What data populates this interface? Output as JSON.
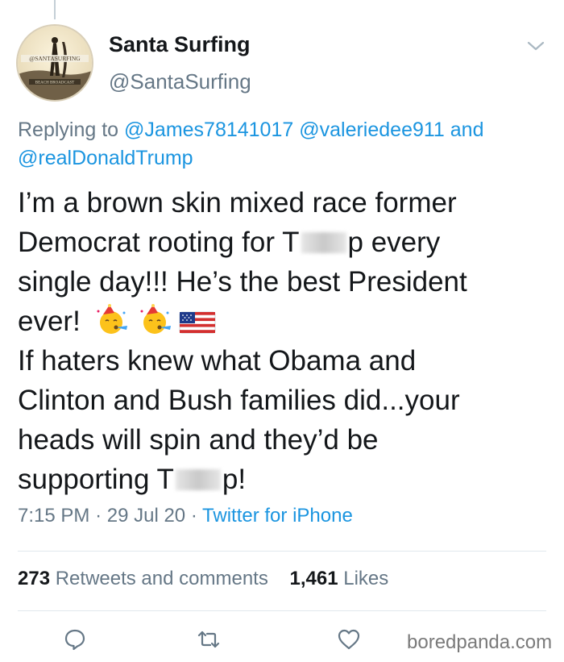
{
  "author": {
    "display_name": "Santa Surfing",
    "handle": "@SantaSurfing",
    "avatar_text_top": "@SANTASURFING",
    "avatar_text_bottom": "BEACH BROADCAST"
  },
  "reply": {
    "prefix": "Replying to",
    "mention_1": "@James78141017",
    "mention_2": "@valeriedee911",
    "conjunction": "and",
    "mention_3": "@realDonaldTrump"
  },
  "tweet": {
    "line_1": "I’m a brown skin mixed race former",
    "line_2a": "Democrat rooting for T",
    "line_2b": "p every",
    "line_3": "single day!!! He’s the best President",
    "line_4": "ever!",
    "line_5": "If haters knew what Obama and",
    "line_6": "Clinton and Bush families did...your",
    "line_7": "heads will spin and they’d be",
    "line_8a": "supporting T",
    "line_8b": "p!",
    "emojis": [
      "partying-face-emoji",
      "partying-face-emoji",
      "us-flag-emoji"
    ]
  },
  "meta": {
    "time": "7:15 PM",
    "separator": "·",
    "date": "29 Jul 20",
    "source": "Twitter for iPhone"
  },
  "stats": {
    "retweets_count": "273",
    "retweets_label": "Retweets and comments",
    "likes_count": "1,461",
    "likes_label": "Likes"
  },
  "actions": [
    "reply-icon",
    "retweet-icon",
    "like-icon"
  ],
  "watermark": "boredpanda.com",
  "colors": {
    "text": "#14171a",
    "secondary": "#657786",
    "link": "#1b95e0",
    "divider": "#e1e8ed"
  }
}
